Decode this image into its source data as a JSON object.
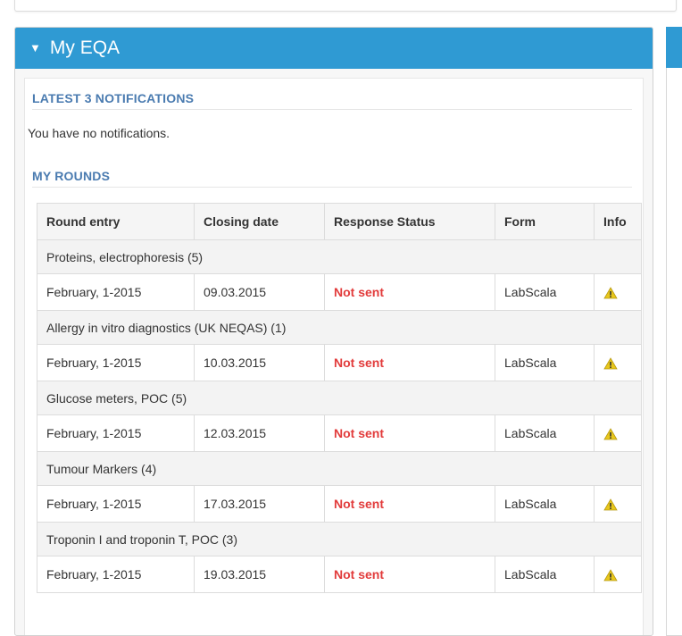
{
  "panel": {
    "title": "My EQA"
  },
  "notifications": {
    "heading": "LATEST 3 NOTIFICATIONS",
    "empty_text": "You have no notifications."
  },
  "rounds": {
    "heading": "MY ROUNDS",
    "columns": [
      "Round entry",
      "Closing date",
      "Response Status",
      "Form",
      "Info"
    ],
    "groups": [
      {
        "name": "Proteins, electrophoresis (5)",
        "entry": "February, 1-2015",
        "closing": "09.03.2015",
        "status": "Not sent",
        "form": "LabScala"
      },
      {
        "name": "Allergy in vitro diagnostics (UK NEQAS) (1)",
        "entry": "February, 1-2015",
        "closing": "10.03.2015",
        "status": "Not sent",
        "form": "LabScala"
      },
      {
        "name": "Glucose meters, POC (5)",
        "entry": "February, 1-2015",
        "closing": "12.03.2015",
        "status": "Not sent",
        "form": "LabScala"
      },
      {
        "name": "Tumour Markers (4)",
        "entry": "February, 1-2015",
        "closing": "17.03.2015",
        "status": "Not sent",
        "form": "LabScala"
      },
      {
        "name": "Troponin I and troponin T, POC (3)",
        "entry": "February, 1-2015",
        "closing": "19.03.2015",
        "status": "Not sent",
        "form": "LabScala"
      }
    ]
  },
  "colors": {
    "header": "#2f9ad3",
    "section": "#4a7bb0",
    "not_sent": "#e23b3b",
    "warning": "#e8c71c"
  },
  "icons": {
    "collapse": "caret-down-icon",
    "info": "warning-icon"
  }
}
